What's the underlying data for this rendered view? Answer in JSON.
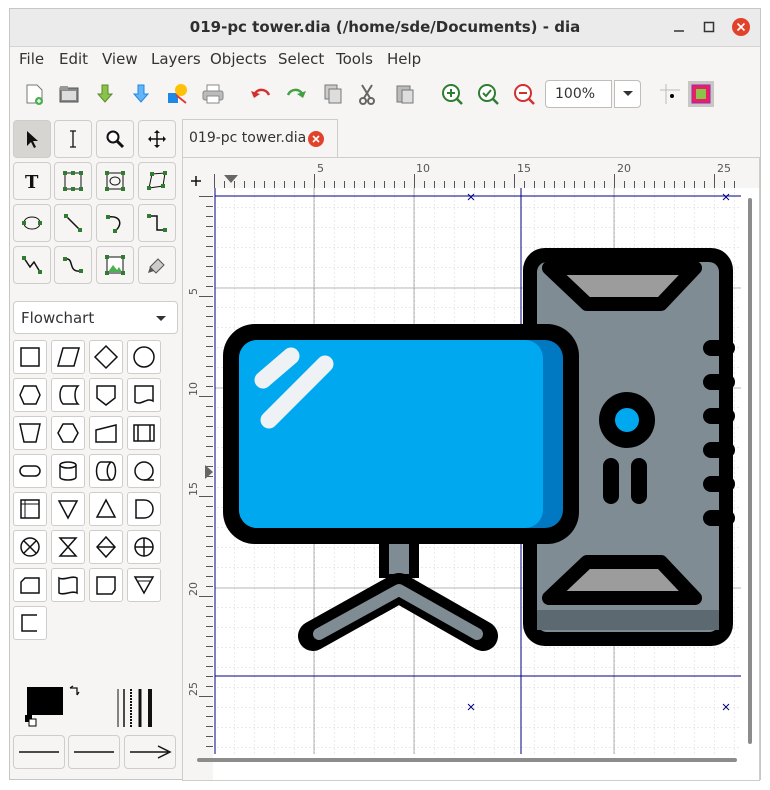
{
  "window": {
    "title": "019-pc tower.dia (/home/sde/Documents) - dia"
  },
  "menu": [
    "File",
    "Edit",
    "View",
    "Layers",
    "Objects",
    "Select",
    "Tools",
    "Help"
  ],
  "toolbar": {
    "zoom_value": "100%"
  },
  "sheet": {
    "name": "Flowchart"
  },
  "tab": {
    "label": "019-pc tower.dia"
  },
  "ruler": {
    "h_labels": [
      "5",
      "10",
      "15",
      "20",
      "25"
    ],
    "v_labels": [
      "5",
      "10",
      "15",
      "20",
      "25"
    ]
  },
  "colors": {
    "accent": "#00a8ef",
    "screen_dark": "#0079c2",
    "case": "#7f8c94",
    "case_top": "#9c9c9c",
    "outline": "#000000",
    "close_red": "#e1432a"
  }
}
